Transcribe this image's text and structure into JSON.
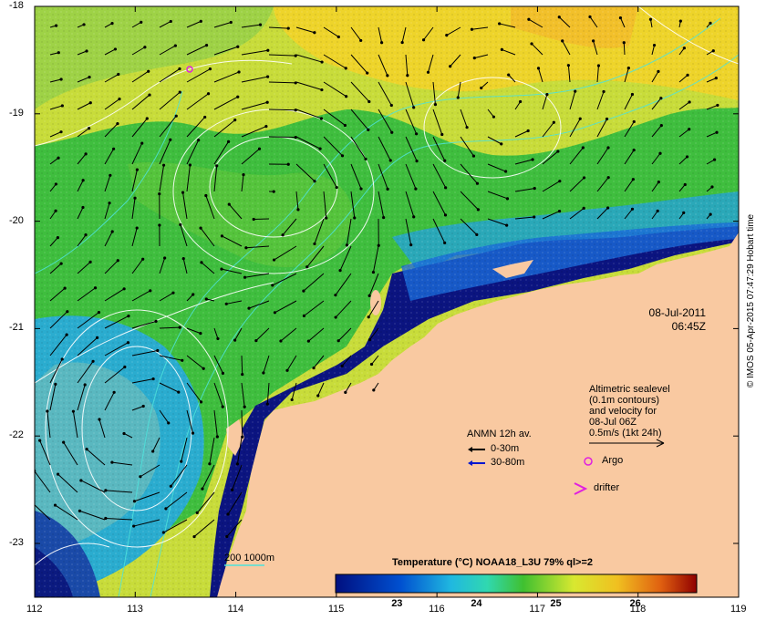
{
  "axes": {
    "lat_ticks": [
      "-18",
      "-19",
      "-20",
      "-21",
      "-22",
      "-23"
    ],
    "lon_ticks": [
      "112",
      "113",
      "114",
      "115",
      "116",
      "117",
      "118",
      "119"
    ],
    "lon_range": [
      112,
      119
    ],
    "lat_range": [
      -23.5,
      -18
    ]
  },
  "datetime": {
    "date": "08-Jul-2011",
    "time": "06:45Z"
  },
  "altimetry_note": {
    "line1": "Altimetric sealevel",
    "line2": "(0.1m contours)",
    "line3": "and velocity for",
    "line4": "08-Jul 06Z",
    "line5": "0.5m/s (1kt 24h)"
  },
  "legend": {
    "anmn_title": "ANMN 12h av.",
    "depth1": "0-30m",
    "depth2": "30-80m",
    "argo": "Argo",
    "drifter": "drifter",
    "depth_contours": "200  1000m"
  },
  "colorbar": {
    "title": "Temperature (°C) NOAA18_L3U 79% ql>=2",
    "ticks": [
      "23",
      "24",
      "25",
      "26"
    ]
  },
  "credit": "© IMOS 05-Apr-2015 07:47:29 Hobart time",
  "colors": {
    "land": "#f9c9a1",
    "cold": "#0b1480",
    "cool": "#21a8e0",
    "mid": "#39c23a",
    "warm": "#c8e034",
    "hot": "#f0c820",
    "contour": "#ffffff",
    "bathy": "#4ee3dc",
    "argo": "#e020e0",
    "drifter": "#e020e0"
  }
}
